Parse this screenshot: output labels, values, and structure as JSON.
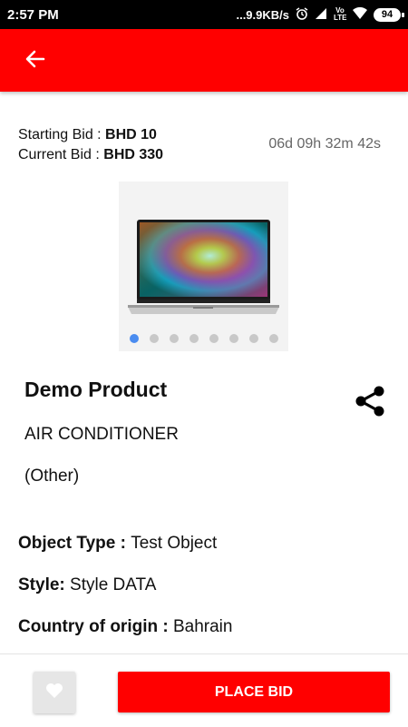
{
  "status_bar": {
    "time": "2:57 PM",
    "network_speed": "...9.9KB/s",
    "carrier": "Vo LTE",
    "battery": "94"
  },
  "bid": {
    "starting_label": "Starting Bid : ",
    "starting_value": "BHD 10",
    "current_label": "Current Bid : ",
    "current_value": "BHD 330",
    "countdown": "06d 09h 32m 42s"
  },
  "gallery": {
    "image_count": 8,
    "active_index": 0
  },
  "product": {
    "name": "Demo Product",
    "category": "AIR CONDITIONER",
    "subcategory": "(Other)"
  },
  "attributes": [
    {
      "key": "Object Type : ",
      "value": "Test Object"
    },
    {
      "key": "Style: ",
      "value": "Style DATA"
    },
    {
      "key": "Country of origin : ",
      "value": "Bahrain"
    }
  ],
  "actions": {
    "place_bid_label": "PLACE BID"
  },
  "colors": {
    "accent": "#ff0000",
    "dot_active": "#4a8cf0",
    "dot_inactive": "#c8c8c8"
  },
  "icons": {
    "back": "arrow-left-icon",
    "share": "share-icon",
    "favorite": "heart-icon"
  }
}
